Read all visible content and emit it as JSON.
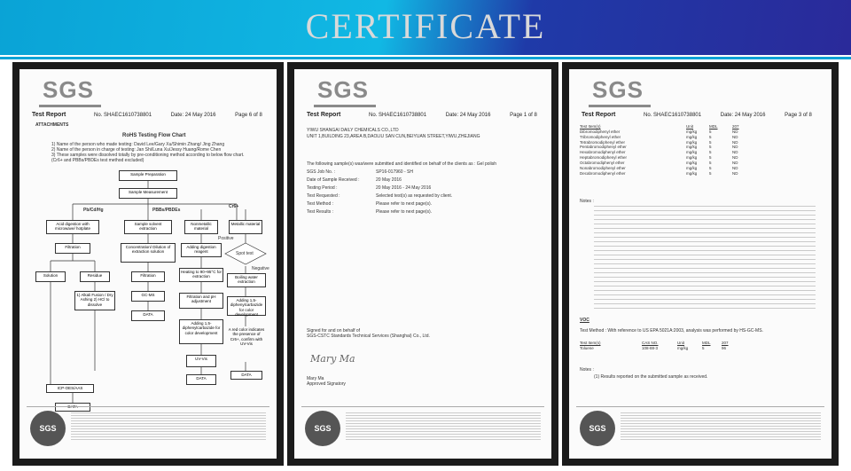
{
  "banner": {
    "title": "CERTIFICATE"
  },
  "logo": "SGS",
  "doc1": {
    "report_label": "Test Report",
    "no": "No. SHAEC1610738801",
    "date": "Date: 24 May 2016",
    "page": "Page 6 of 8",
    "attachments": "ATTACHMENTS",
    "chart_title": "RoHS Testing Flow Chart",
    "notes": [
      "1) Name of the person who made testing: David Lee/Gary Xu/Shimin Zhang/ Jing Zhang",
      "2) Name of the person in charge of testing: Jan Shi/Luna Xu/Jessy Huang/Rome Chen",
      "3) These samples were dissolved totally by pre-conditioning method according to below flow chart.",
      "(Cr6+ and PBBs/PBDEs test method excluded)"
    ],
    "flow": {
      "prep": "Sample Preparation",
      "measure": "Sample Measurement",
      "col1": "Pb/Cd/Hg",
      "col2": "PBBs/PBDEs",
      "col3": "Cr6+",
      "acid": "Acid digestion with microwave/ hotplate",
      "filtration": "Filtration",
      "solution": "Solution",
      "residue": "Residue",
      "alkali": "1) Alkali Fusion / Dry Ashing 2) HCl to dissolve",
      "icp": "ICP-OES/AAS",
      "data": "DATA",
      "solvent": "Sample solvent extraction",
      "conc": "Concentration/ Dilution of extraction solution",
      "filt2": "Filtration",
      "gcms": "GC-MS",
      "nonmetal": "Nonmetallic material",
      "metal": "Metallic material",
      "alk_digest": "Adding digestion reagent",
      "heating": "Heating to 90~95°C for extraction",
      "filt_ph": "Filtration and pH adjustment",
      "diphenyl": "Adding 1,5-diphenylcarbazide for color development",
      "uvvis": "UV-Vis",
      "positive": "Positive",
      "spot": "Spot test",
      "negative": "Negative",
      "boiling": "Boiling water extraction",
      "diphenyl2": "Adding 1,5-diphenylcarbazide for color development",
      "red": "A red color indicates the presence of Cr6+, confirm with UV-Vis",
      "data3": "DATA"
    }
  },
  "doc2": {
    "report_label": "Test Report",
    "no": "No. SHAEC1610738801",
    "date": "Date: 24 May 2016",
    "page": "Page 1 of 8",
    "company": "YIWU SHANGAI DAILY CHEMICALS CO.,LTD",
    "address": "UNIT 1,BUILDING 23,AREA B,DAOLIU SAN CUN,BEIYUAN STREET,YIWU,ZHEJIANG",
    "intro": "The following sample(s) was/were submitted and identified on behalf of the clients as : Gel polish",
    "fields": [
      {
        "k": "SGS Job No. :",
        "v": "SP16-017960 - SH"
      },
      {
        "k": "Date of Sample Received :",
        "v": "20 May 2016"
      },
      {
        "k": "Testing Period :",
        "v": "20 May 2016 - 24 May 2016"
      },
      {
        "k": "Test Requested :",
        "v": "Selected test(s) as requested by client."
      },
      {
        "k": "Test Method :",
        "v": "Please refer to next page(s)."
      },
      {
        "k": "Test Results :",
        "v": "Please refer to next page(s)."
      }
    ],
    "signed1": "Signed for and on behalf of",
    "signed2": "SGS-CSTC Standards Technical Services (Shanghai) Co., Ltd.",
    "signature": "Mary Ma",
    "name": "Mary Ma",
    "title": "Approved Signatory"
  },
  "doc3": {
    "report_label": "Test Report",
    "no": "No. SHAEC1610738801",
    "date": "Date: 24 May 2016",
    "page": "Page 3 of 8",
    "headers": [
      "Test Item(s)",
      "Unit",
      "MDL",
      "207"
    ],
    "rows": [
      "Dibromodiphenyl ether",
      "Tribromodiphenyl ether",
      "Tetrabromodiphenyl ether",
      "Pentabromodiphenyl ether",
      "Hexabromodiphenyl ether",
      "Heptabromodiphenyl ether",
      "Octabromodiphenyl ether",
      "Nonabromodiphenyl ether",
      "Decabromodiphenyl ether"
    ],
    "unit": "mg/kg",
    "mdl": "5",
    "result": "ND",
    "notes_label": "Notes :",
    "voc": "VOC",
    "voc_method": "Test Method :   With reference to US EPA 5021A:2003, analysis was performed by HS-GC-MS.",
    "voc_headers": [
      "Test Item(s)",
      "CAS NO.",
      "Unit",
      "MDL",
      "207"
    ],
    "voc_row": [
      "Toluene",
      "108-88-3",
      "mg/kg",
      "5",
      "96"
    ],
    "voc_notes": "Notes :",
    "voc_note1": "(1) Results reported on the submitted sample as received."
  },
  "footer_seal": "SGS"
}
